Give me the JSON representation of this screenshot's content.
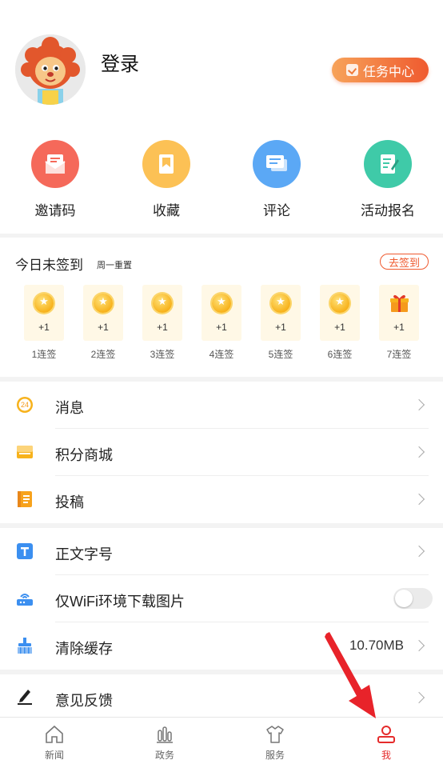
{
  "profile": {
    "login_label": "登录",
    "task_center_label": "任务中心"
  },
  "quick_actions": [
    {
      "label": "邀请码",
      "icon": "envelope-icon",
      "color": "#f5695a"
    },
    {
      "label": "收藏",
      "icon": "bookmark-icon",
      "color": "#fcc155"
    },
    {
      "label": "评论",
      "icon": "comment-icon",
      "color": "#5ba8f5"
    },
    {
      "label": "活动报名",
      "icon": "form-icon",
      "color": "#3fcaa8"
    }
  ],
  "signin": {
    "title": "今日未签到",
    "subtitle": "周一重置",
    "button": "去签到",
    "days": [
      {
        "reward": "+1",
        "label": "1连签"
      },
      {
        "reward": "+1",
        "label": "2连签"
      },
      {
        "reward": "+1",
        "label": "3连签"
      },
      {
        "reward": "+1",
        "label": "4连签"
      },
      {
        "reward": "+1",
        "label": "5连签"
      },
      {
        "reward": "+1",
        "label": "6连签"
      },
      {
        "reward": "+1",
        "label": "7连签"
      }
    ]
  },
  "menu1": [
    {
      "label": "消息",
      "badge": "24"
    },
    {
      "label": "积分商城"
    },
    {
      "label": "投稿"
    }
  ],
  "menu2": [
    {
      "label": "正文字号"
    },
    {
      "label": "仅WiFi环境下载图片",
      "toggle_on": false
    },
    {
      "label": "清除缓存",
      "value": "10.70MB"
    }
  ],
  "menu3": [
    {
      "label": "意见反馈"
    }
  ],
  "tabbar": [
    {
      "label": "新闻",
      "icon": "home-icon"
    },
    {
      "label": "政务",
      "icon": "bar-chart-icon"
    },
    {
      "label": "服务",
      "icon": "shirt-icon"
    },
    {
      "label": "我",
      "icon": "person-icon",
      "active": true
    }
  ],
  "colors": {
    "accent": "#ef5a2f",
    "active_tab": "#e52b2b",
    "arrow": "#e8232a"
  }
}
